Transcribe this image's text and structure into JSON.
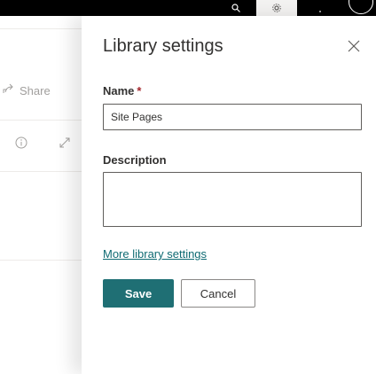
{
  "suite_bar": {
    "icons": [
      "search-icon",
      "gear-icon",
      "help-icon",
      "avatar"
    ],
    "background": "#000000"
  },
  "background_page": {
    "share_label": "Share",
    "icons": [
      "share-icon",
      "info-icon",
      "expand-icon"
    ]
  },
  "panel": {
    "title": "Library settings",
    "close_icon": "close-icon",
    "name": {
      "label": "Name",
      "required_marker": "*",
      "value": "Site Pages"
    },
    "description": {
      "label": "Description",
      "value": ""
    },
    "more_link": "More library settings",
    "save_label": "Save",
    "cancel_label": "Cancel"
  },
  "colors": {
    "accent": "#1f6f74",
    "link": "#0f6b73",
    "required": "#a4262c"
  }
}
